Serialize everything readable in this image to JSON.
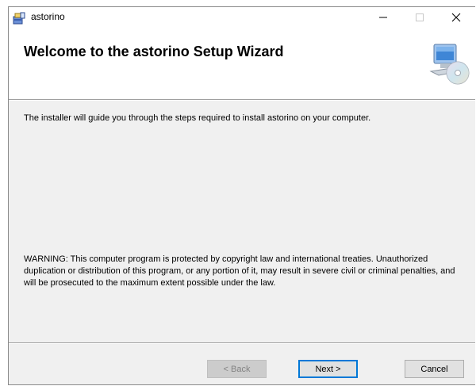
{
  "window": {
    "title": "astorino"
  },
  "header": {
    "title": "Welcome to the astorino Setup Wizard"
  },
  "body": {
    "intro": "The installer will guide you through the steps required to install astorino on your computer.",
    "warning": "WARNING: This computer program is protected by copyright law and international treaties. Unauthorized duplication or distribution of this program, or any portion of it, may result in severe civil or criminal penalties, and will be prosecuted to the maximum extent possible under the law."
  },
  "buttons": {
    "back": "< Back",
    "next": "Next >",
    "cancel": "Cancel"
  },
  "icons": {
    "app": "installer-package-icon",
    "header": "computer-cd-icon",
    "minimize": "minimize-icon",
    "maximize": "maximize-icon",
    "close": "close-icon"
  },
  "colors": {
    "accent": "#0078d7",
    "dialog_bg": "#f0f0f0",
    "header_bg": "#ffffff"
  }
}
